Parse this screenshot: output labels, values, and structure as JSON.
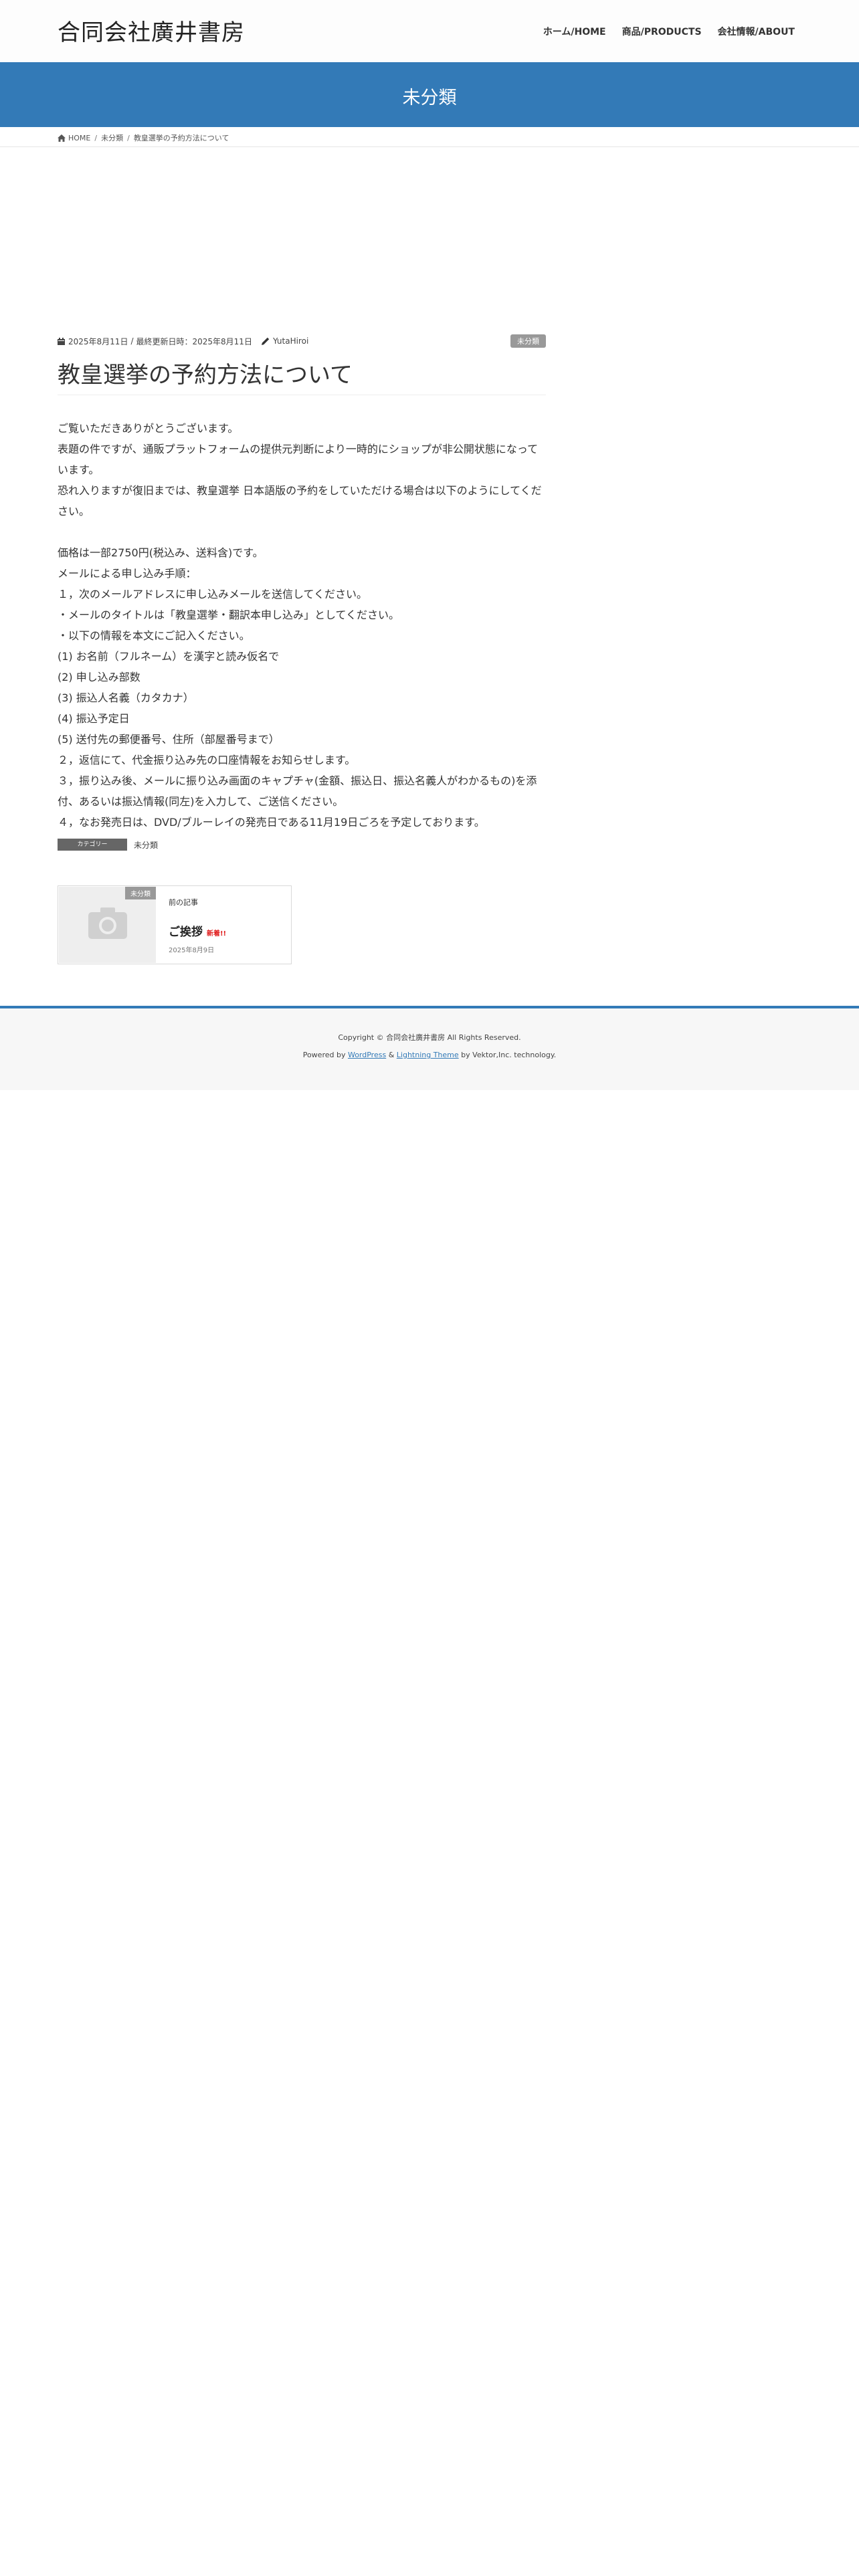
{
  "header": {
    "logo": "合同会社廣井書房",
    "nav": [
      {
        "label": "ホーム/HOME"
      },
      {
        "label": "商品/PRODUCTS"
      },
      {
        "label": "会社情報/ABOUT"
      }
    ]
  },
  "page_header": {
    "title": "未分類"
  },
  "breadcrumb": {
    "home": "HOME",
    "category": "未分類",
    "current": "教皇選挙の予約方法について"
  },
  "entry": {
    "published": "2025年8月11日",
    "updated": "最終更新日時：2025年8月11日",
    "author": "YutaHiroi",
    "category_badge": "未分類",
    "title": "教皇選挙の予約方法について",
    "body": [
      "ご覧いただきありがとうございます。",
      "表題の件ですが、通販プラットフォームの提供元判断により一時的にショップが非公開状態になっています。",
      "恐れ入りますが復旧までは、教皇選挙 日本語版の予約をしていただける場合は以下のようにしてください。",
      "",
      "価格は一部2750円(税込み、送料含)です。",
      "メールによる申し込み手順：",
      "１，次のメールアドレスに申し込みメールを送信してください。",
      "・メールのタイトルは「教皇選挙・翻訳本申し込み」としてください。",
      "・以下の情報を本文にご記入ください。",
      "(1) お名前（フルネーム）を漢字と読み仮名で",
      "(2) 申し込み部数",
      "(3) 振込人名義（カタカナ）",
      "(4) 振込予定日",
      "(5) 送付先の郵便番号、住所（部屋番号まで）",
      "２，返信にて、代金振り込み先の口座情報をお知らせします。",
      "３，振り込み後、メールに振り込み画面のキャプチャ(金額、振込日、振込名義人がわかるもの)を添付、あるいは振込情報(同左)を入力して、ご送信ください。",
      "４，なお発売日は、DVD/ブルーレイの発売日である11月19日ごろを予定しております。"
    ],
    "category_label": "カテゴリー",
    "category_value": "未分類"
  },
  "prev_post": {
    "thumb_badge": "未分類",
    "label": "前の記事",
    "title": "ご挨拶",
    "new_badge": "新着!!",
    "date": "2025年8月9日"
  },
  "footer": {
    "copyright": "Copyright © 合同会社廣井書房 All Rights Reserved.",
    "powered_prefix": "Powered by ",
    "wordpress": "WordPress",
    "amp": " & ",
    "theme": "Lightning Theme",
    "by": " by Vektor,Inc. technology."
  },
  "colors": {
    "accent": "#337ab7",
    "badge_gray": "#999999",
    "new_red": "#e02020"
  }
}
